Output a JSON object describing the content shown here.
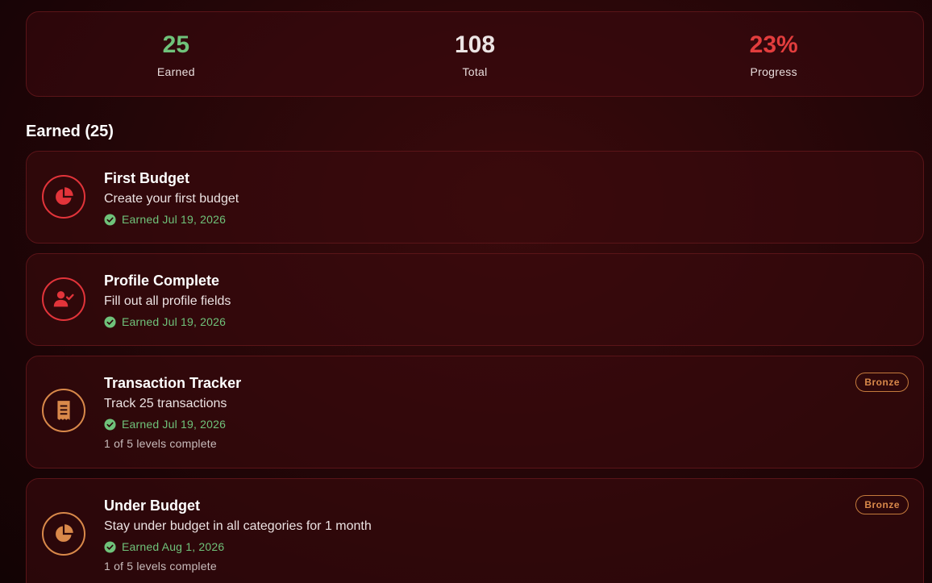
{
  "colors": {
    "earned_green": "#6fc27a",
    "total_white": "#ece4e4",
    "progress_red": "#e23d3d",
    "red_badge": "#e2343a",
    "bronze_badge": "#d9894a"
  },
  "stats": {
    "earned": {
      "value": "25",
      "label": "Earned"
    },
    "total": {
      "value": "108",
      "label": "Total"
    },
    "progress": {
      "value": "23%",
      "label": "Progress"
    }
  },
  "section": {
    "title": "Earned (25)"
  },
  "achievements": [
    {
      "title": "First Budget",
      "description": "Create your first budget",
      "earned": "Earned Jul 19, 2026",
      "icon": "pie-chart-icon",
      "tier_color": "red"
    },
    {
      "title": "Profile Complete",
      "description": "Fill out all profile fields",
      "earned": "Earned Jul 19, 2026",
      "icon": "user-check-icon",
      "tier_color": "red"
    },
    {
      "title": "Transaction Tracker",
      "description": "Track 25 transactions",
      "earned": "Earned Jul 19, 2026",
      "levels": "1 of 5 levels complete",
      "badge": "Bronze",
      "icon": "receipt-icon",
      "tier_color": "bronze"
    },
    {
      "title": "Under Budget",
      "description": "Stay under budget in all categories for 1 month",
      "earned": "Earned Aug 1, 2026",
      "levels": "1 of 5 levels complete",
      "badge": "Bronze",
      "icon": "pie-chart-icon",
      "tier_color": "bronze"
    }
  ]
}
